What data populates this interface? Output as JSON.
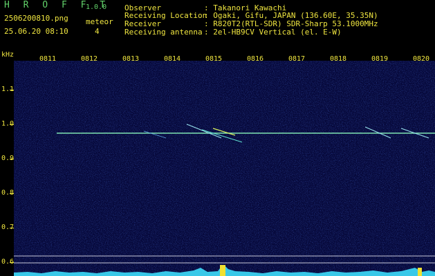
{
  "app": {
    "name": "H R O F F T",
    "version": "1.0.0"
  },
  "file": {
    "name": "2506200810.png",
    "datetime": "25.06.20 08:10"
  },
  "meteor": {
    "label": "meteor",
    "count": "4"
  },
  "info": [
    {
      "key": "Observer",
      "value": ": Takanori Kawachi"
    },
    {
      "key": "Receiving Location",
      "value": ": Ogaki, Gifu, JAPAN (136.60E, 35.35N)"
    },
    {
      "key": "Receiver",
      "value": ": R820T2(RTL-SDR) SDR-Sharp 53.1000MHz"
    },
    {
      "key": "Receiving antenna",
      "value": ": 2el-HB9CV Vertical (el. E-W)"
    }
  ],
  "axis": {
    "y_unit": "kHz",
    "y_labels": [
      "1.1",
      "1.0",
      "0.9",
      "0.8",
      "0.7",
      "0.6"
    ],
    "x_labels": [
      "0811",
      "0812",
      "0813",
      "0814",
      "0815",
      "0816",
      "0817",
      "0818",
      "0819",
      "0820"
    ]
  },
  "colors": {
    "label_yellow": "#f0e640",
    "brand_green": "#62d26a",
    "background": "#06083a",
    "trace": "#5fe0d0"
  }
}
